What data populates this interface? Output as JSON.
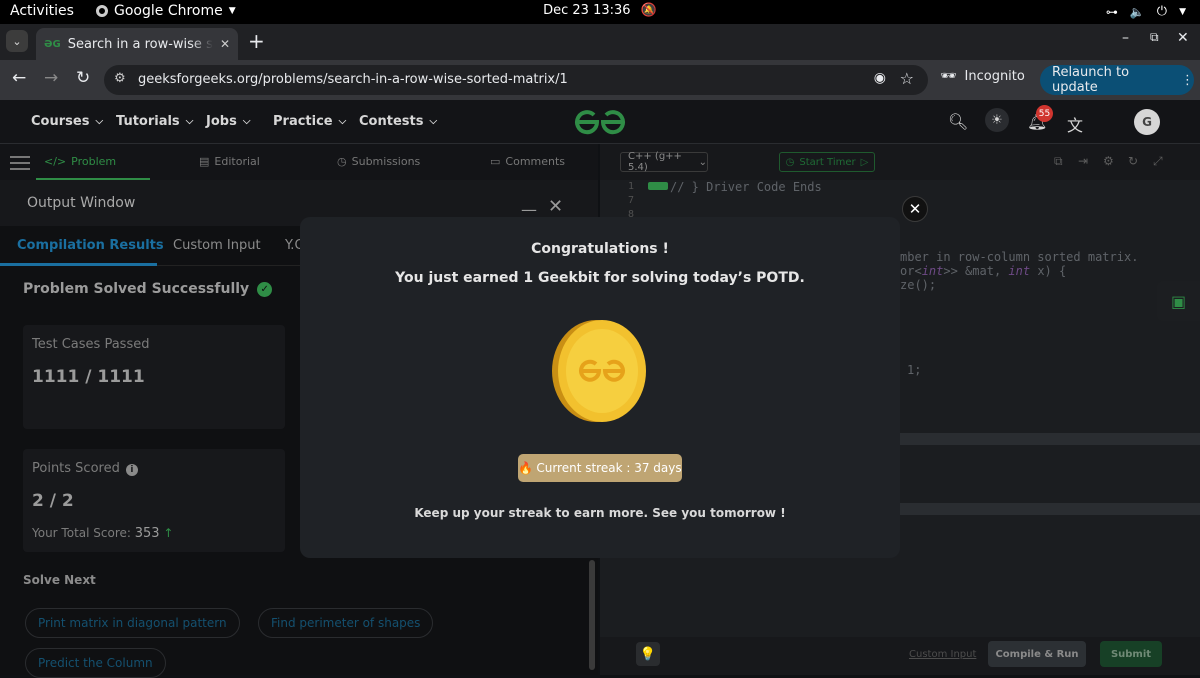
{
  "os": {
    "activities": "Activities",
    "app_name": "Google Chrome",
    "clock": "Dec 23  13:36"
  },
  "browser": {
    "tab_title": "Search in a row-wise sorted matrix",
    "url": "geeksforgeeks.org/problems/search-in-a-row-wise-sorted-matrix/1",
    "incognito_label": "Incognito",
    "relaunch_label": "Relaunch to update"
  },
  "header": {
    "menu": [
      "Courses",
      "Tutorials",
      "Jobs",
      "Practice",
      "Contests"
    ],
    "notification_count": "55",
    "avatar_letter": "G"
  },
  "problem_tabs": [
    "Problem",
    "Editorial",
    "Submissions",
    "Comments"
  ],
  "output_window": {
    "title": "Output Window",
    "tabs": [
      "Compilation Results",
      "Custom Input",
      "Y.O"
    ],
    "status": "Problem Solved Successfully",
    "test_cases_label": "Test Cases Passed",
    "test_cases_value": "1111 / 1111",
    "points_label": "Points Scored",
    "points_value": "2 / 2",
    "total_score_label": "Your Total Score:",
    "total_score_value": "353",
    "solve_next_label": "Solve Next",
    "solve_next_items": [
      "Print matrix in diagonal pattern",
      "Find perimeter of shapes",
      "Predict the Column"
    ]
  },
  "editor": {
    "language": "C++ (g++ 5.4)",
    "timer_label": "Start Timer",
    "line_numbers": [
      "1",
      "7",
      "8"
    ],
    "code_line_1": "// } Driver Code Ends",
    "code_fragment_1": "mber in row-column sorted matrix.",
    "code_fragment_2_pre": "or<",
    "code_fragment_2_kw": "int",
    "code_fragment_2_mid": ">> &mat, ",
    "code_fragment_2_kw2": "int",
    "code_fragment_2_post": " x) {",
    "code_fragment_3": "ze();",
    "code_fragment_4": "1;",
    "custom_input_label": "Custom Input",
    "compile_label": "Compile & Run",
    "submit_label": "Submit"
  },
  "modal": {
    "title": "Congratulations !",
    "message": "You just earned 1 Geekbit for solving today’s POTD.",
    "streak_icon": "🔥",
    "streak": "Current streak : 37 days",
    "footer": "Keep up your streak to earn more. See you tomorrow !"
  },
  "colors": {
    "brand_green": "#2f8d46",
    "coin_gold": "#f2c12e",
    "streak_bg": "#bfa573",
    "relaunch_bg": "#0b4f75",
    "badge_red": "#d0352f"
  }
}
